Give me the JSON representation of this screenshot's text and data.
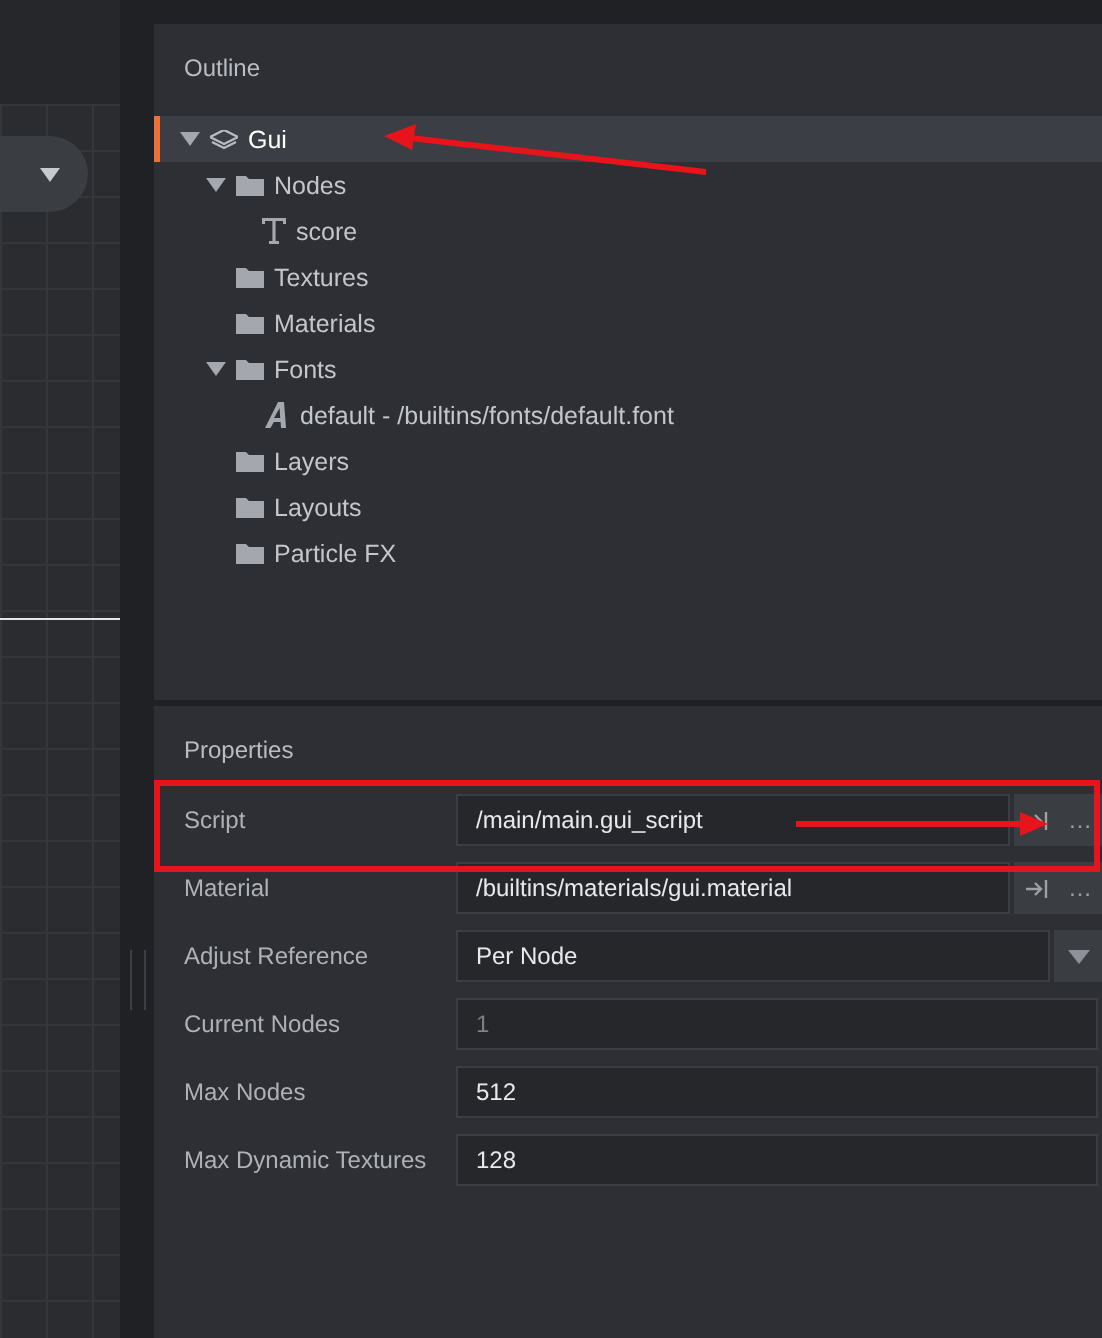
{
  "outline": {
    "title": "Outline",
    "tree": [
      {
        "label": "Gui",
        "kind": "gui",
        "selected": true,
        "expanded": true,
        "children": [
          {
            "label": "Nodes",
            "kind": "folder",
            "selected": false,
            "expanded": true,
            "children": [
              {
                "label": "score",
                "kind": "text",
                "selected": false
              }
            ]
          },
          {
            "label": "Textures",
            "kind": "folder",
            "selected": false
          },
          {
            "label": "Materials",
            "kind": "folder",
            "selected": false
          },
          {
            "label": "Fonts",
            "kind": "folder",
            "selected": false,
            "expanded": true,
            "children": [
              {
                "label": "default - /builtins/fonts/default.font",
                "kind": "font",
                "selected": false
              }
            ]
          },
          {
            "label": "Layers",
            "kind": "folder",
            "selected": false
          },
          {
            "label": "Layouts",
            "kind": "folder",
            "selected": false
          },
          {
            "label": "Particle FX",
            "kind": "folder",
            "selected": false
          }
        ]
      }
    ]
  },
  "properties": {
    "title": "Properties",
    "rows": [
      {
        "label": "Script",
        "kind": "resource",
        "value": "/main/main.gui_script",
        "browse": "…"
      },
      {
        "label": "Material",
        "kind": "resource",
        "value": "/builtins/materials/gui.material",
        "browse": "…"
      },
      {
        "label": "Adjust Reference",
        "kind": "select",
        "value": "Per Node"
      },
      {
        "label": "Current Nodes",
        "kind": "text",
        "value": "1",
        "disabled": true
      },
      {
        "label": "Max Nodes",
        "kind": "text",
        "value": "512",
        "disabled": false
      },
      {
        "label": "Max Dynamic Textures",
        "kind": "text",
        "value": "128",
        "disabled": false
      }
    ]
  }
}
